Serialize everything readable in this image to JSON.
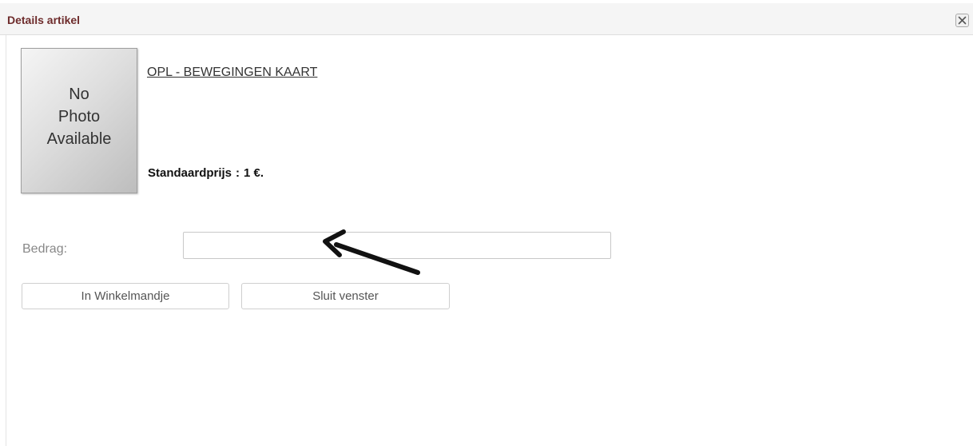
{
  "dialog": {
    "title": "Details artikel",
    "close_icon": "close-icon"
  },
  "article": {
    "image_text_line1": "No",
    "image_text_line2": "Photo",
    "image_text_line3": "Available",
    "name": "OPL - BEWEGINGEN KAART",
    "price_label": "Standaardprijs",
    "price_separator": ":",
    "price_value": "1 €."
  },
  "form": {
    "amount_label": "Bedrag:",
    "amount_value": "",
    "amount_placeholder": ""
  },
  "buttons": {
    "add_to_cart": "In Winkelmandje",
    "close_window": "Sluit venster"
  },
  "colors": {
    "title": "#6e2c2c",
    "annotation_arrow": "#111111"
  }
}
